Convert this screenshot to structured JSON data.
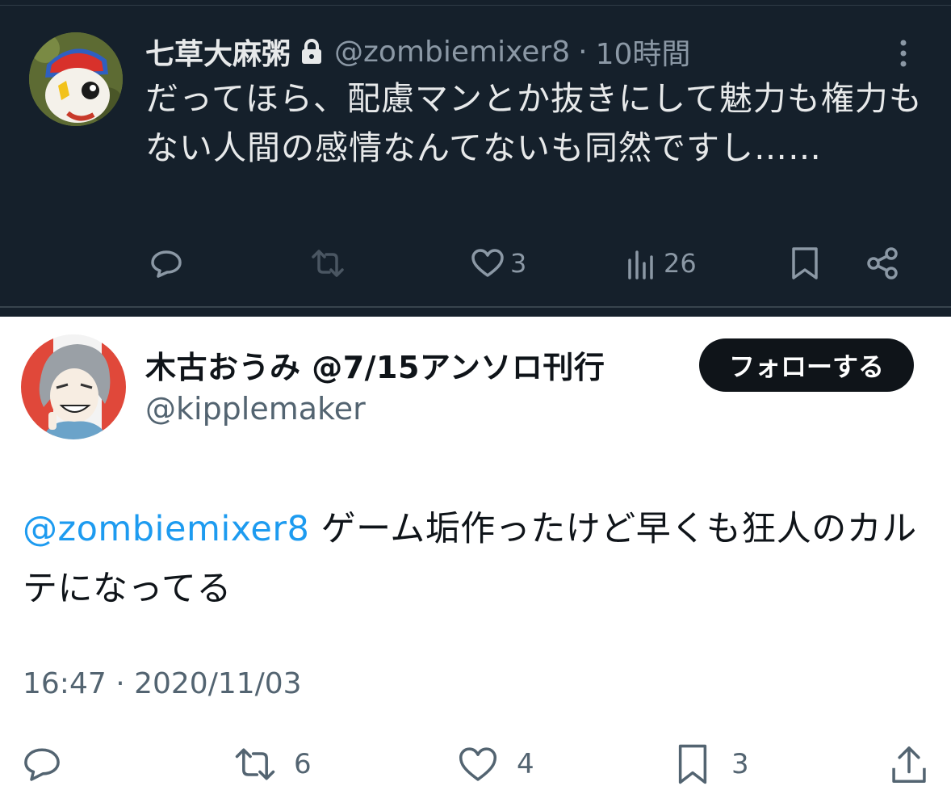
{
  "dark_tweet": {
    "display_name": "七草大麻粥",
    "handle": "@zombiemixer8",
    "separator": "·",
    "time_ago": "10時間",
    "text": "だってほら、配慮マンとか抜きにして魅力も権力もない人間の感情なんてないも同然ですし……",
    "actions": {
      "reply_count": "",
      "retweet_count": "",
      "like_count": "3",
      "views_count": "26"
    },
    "colors": {
      "background": "#15202b",
      "text": "#e7e9ea",
      "muted": "#8b98a5"
    },
    "icons": [
      "lock-icon",
      "more-vertical-icon",
      "reply-icon",
      "retweet-icon",
      "like-icon",
      "views-icon",
      "bookmark-icon",
      "share-icon"
    ]
  },
  "light_tweet": {
    "display_name": "木古おうみ @7/15アンソロ刊行",
    "handle": "@kipplemaker",
    "follow_label": "フォローする",
    "mention": "@zombiemixer8",
    "text": " ゲーム垢作ったけど早くも狂人のカルテになってる",
    "timestamp": "16:47 · 2020/11/03",
    "actions": {
      "retweet_count": "6",
      "like_count": "4",
      "bookmark_count": "3"
    },
    "colors": {
      "accent": "#1d9bf0",
      "text": "#0f1419",
      "muted": "#536471"
    },
    "icons": [
      "reply-icon",
      "retweet-icon",
      "like-icon",
      "bookmark-icon",
      "upload-share-icon"
    ]
  }
}
